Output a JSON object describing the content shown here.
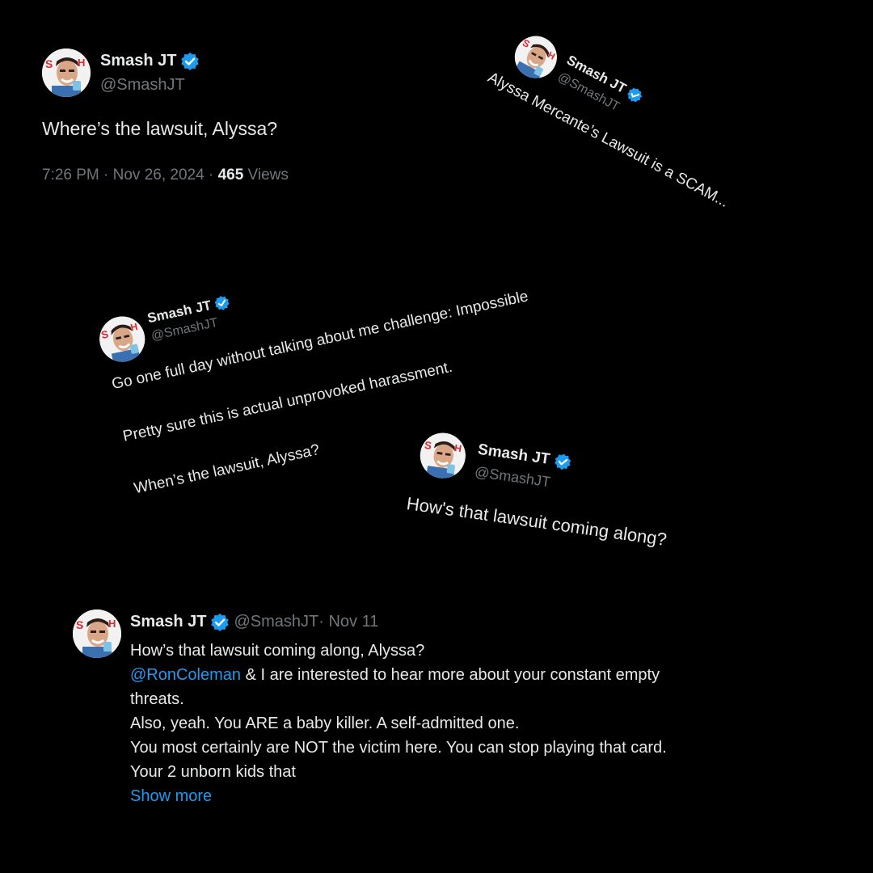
{
  "colors": {
    "background": "#000000",
    "text": "#e7e9ea",
    "muted": "#71767b",
    "link": "#1d9bf0",
    "verified": "#1d9bf0"
  },
  "tweet1": {
    "name": "Smash JT",
    "handle": "@SmashJT",
    "text": "Where’s the lawsuit, Alyssa?",
    "time": "7:26 PM · Nov 26, 2024 · ",
    "views_count": "465",
    "views_label": " Views"
  },
  "tweet2": {
    "name": "Smash JT",
    "handle": "@SmashJT",
    "text": "Alyssa Mercante’s Lawsuit is a SCAM..."
  },
  "tweet3": {
    "name": "Smash JT",
    "handle": "@SmashJT",
    "line1": "Go one full day without talking about me challenge: Impossible",
    "line2": "Pretty sure this is actual unprovoked harassment.",
    "line3": "When’s the lawsuit, Alyssa?"
  },
  "tweet4": {
    "name": "Smash JT",
    "handle": "@SmashJT",
    "text": "How's that lawsuit coming along?"
  },
  "tweet5": {
    "name": "Smash JT",
    "handle": "@SmashJT",
    "date": " · Nov 11",
    "line1": "How’s that lawsuit coming along, Alyssa?",
    "mention": "@RonColeman",
    "line2_rest": " & I are interested to hear more about your constant empty",
    "line3": "threats.",
    "line4": "Also, yeah. You ARE a baby killer. A self-admitted one.",
    "line5": "You most certainly are NOT the victim here.  You can stop playing that card.",
    "line6": "Your 2 unborn kids that",
    "show_more": "Show more"
  },
  "icons": {
    "verified": "verified-badge-icon",
    "avatar": "profile-avatar"
  }
}
